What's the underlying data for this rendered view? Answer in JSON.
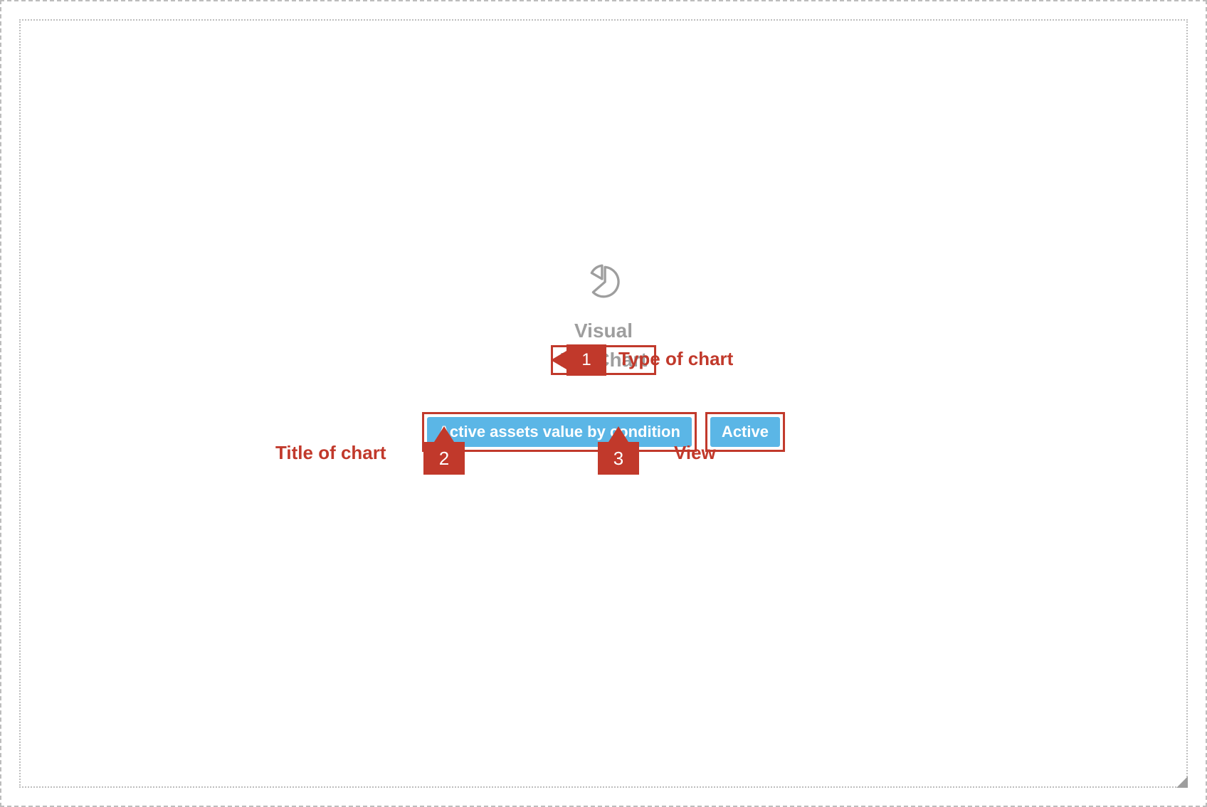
{
  "widget": {
    "visual_label": "Visual",
    "chart_type": "Pie Chart",
    "chart_title_chip": "Active assets value by condition",
    "view_chip": "Active"
  },
  "annotations": {
    "callout1": {
      "number": "1",
      "label": "Type of chart"
    },
    "callout2": {
      "number": "2",
      "label": "Title of chart"
    },
    "callout3": {
      "number": "3",
      "label": "View"
    }
  }
}
